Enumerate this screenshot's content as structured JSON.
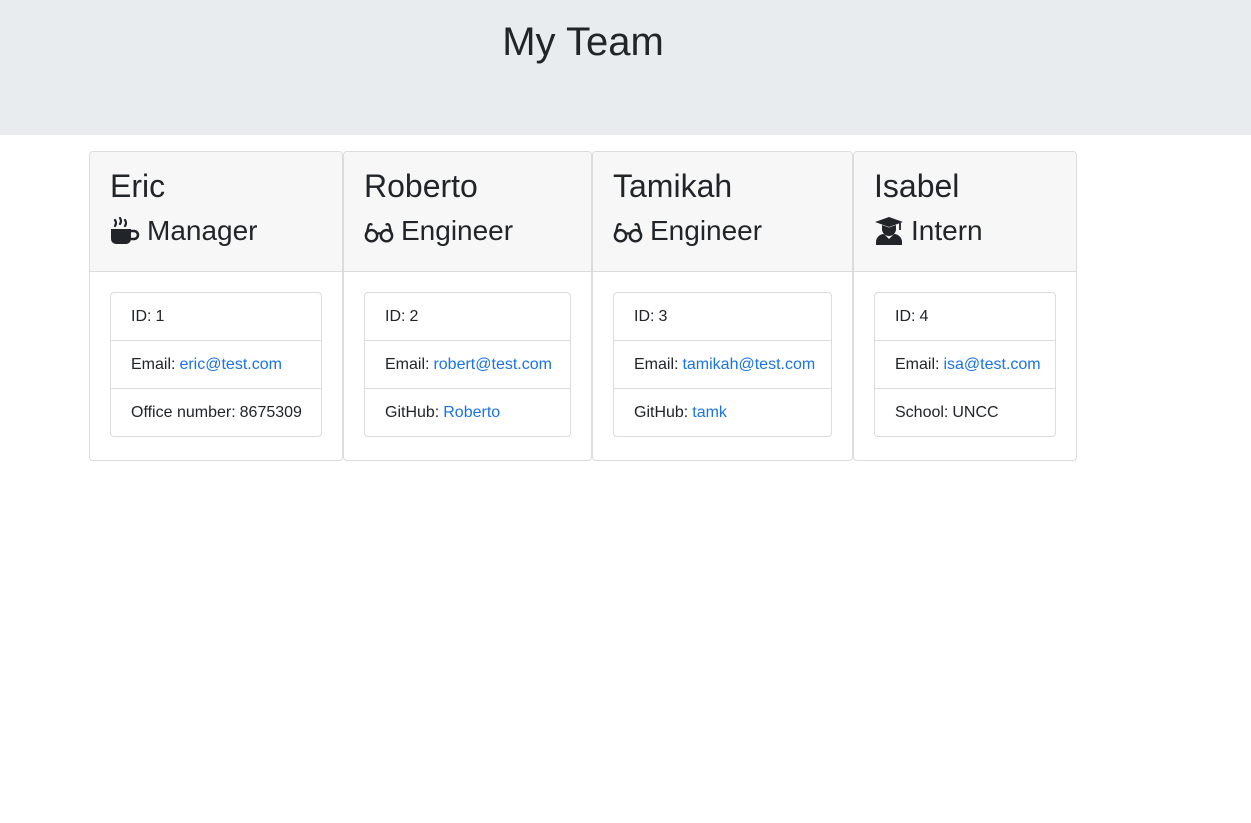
{
  "header": {
    "title": "My Team"
  },
  "cards": [
    {
      "name": "Eric",
      "role": "Manager",
      "icon": "coffee-mug-icon",
      "id_label": "ID:",
      "id": "1",
      "email_label": "Email:",
      "email": "eric@test.com",
      "extra_label": "Office number:",
      "extra_value": "8675309"
    },
    {
      "name": "Roberto",
      "role": "Engineer",
      "icon": "glasses-icon",
      "id_label": "ID:",
      "id": "2",
      "email_label": "Email:",
      "email": "robert@test.com",
      "extra_label": "GitHub:",
      "extra_value": "Roberto"
    },
    {
      "name": "Tamikah",
      "role": "Engineer",
      "icon": "glasses-icon",
      "id_label": "ID:",
      "id": "3",
      "email_label": "Email:",
      "email": "tamikah@test.com",
      "extra_label": "GitHub:",
      "extra_value": "tamk"
    },
    {
      "name": "Isabel",
      "role": "Intern",
      "icon": "graduate-icon",
      "id_label": "ID:",
      "id": "4",
      "email_label": "Email:",
      "email": "isa@test.com",
      "extra_label": "School:",
      "extra_value": "UNCC"
    }
  ],
  "colors": {
    "jumbotron": "#e9ecef",
    "link": "#1a73e8",
    "text": "#212529"
  }
}
